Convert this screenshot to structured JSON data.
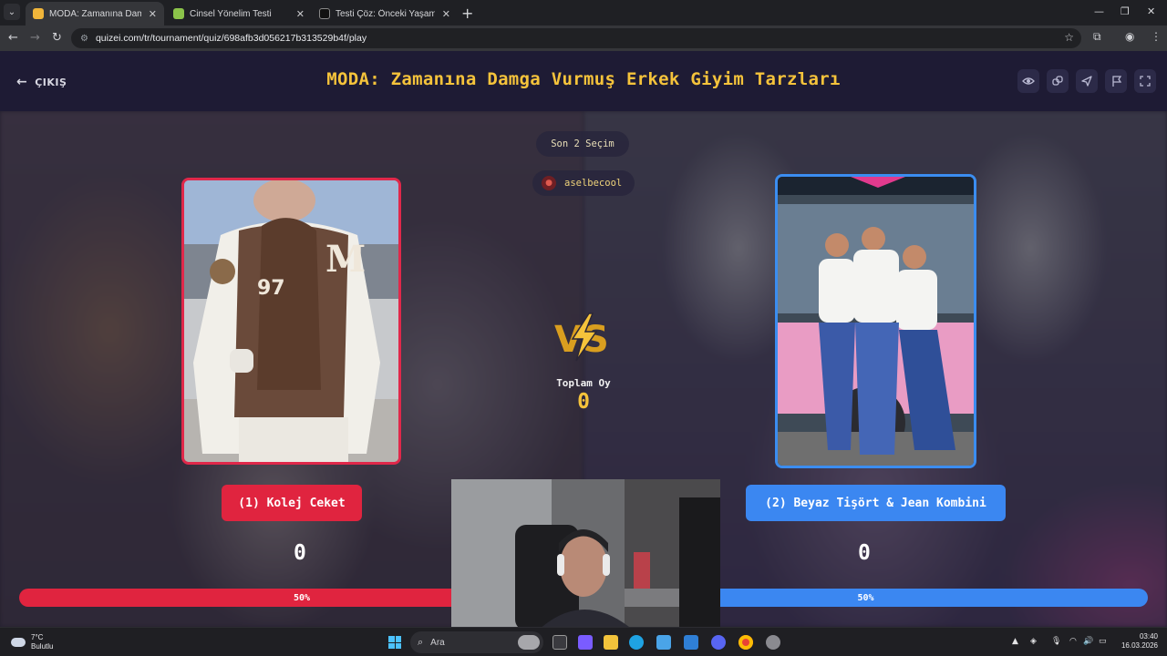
{
  "browser": {
    "tabs": [
      {
        "title": "MODA: Zamanına Damga Vurmuş",
        "active": true
      },
      {
        "title": "Cinsel Yönelim Testi",
        "active": false
      },
      {
        "title": "Testi Çöz: Önceki Yaşamındaki Ci",
        "active": false
      }
    ],
    "url": "quizei.com/tr/tournament/quiz/698afb3d056217b313529b4f/play"
  },
  "page": {
    "exit_label": "ÇIKIŞ",
    "title": "MODA: Zamanına Damga Vurmuş Erkek Giyim Tarzları",
    "round_label": "Son 2 Seçim",
    "username": "aselbecool",
    "vs_label": "VS",
    "total_votes_label": "Toplam Oy",
    "total_votes": "0",
    "left": {
      "label": "(1) Kolej Ceket",
      "votes": "0",
      "percent_label": "50%",
      "percent": 50
    },
    "right": {
      "label": "(2) Beyaz Tişört & Jean Kombini",
      "votes": "0",
      "percent_label": "50%",
      "percent": 50
    },
    "toolbar_icons": [
      "eye-icon",
      "link-icon",
      "send-icon",
      "flag-icon",
      "fullscreen-icon"
    ]
  },
  "taskbar": {
    "weather_temp": "7°C",
    "weather_desc": "Bulutlu",
    "search_placeholder": "Ara",
    "time": "03:40",
    "date": "16.03.2026"
  },
  "colors": {
    "accent_gold": "#f5c33b",
    "left_red": "#e0243f",
    "right_blue": "#3b87f1",
    "header_bg": "#1e1b34"
  }
}
